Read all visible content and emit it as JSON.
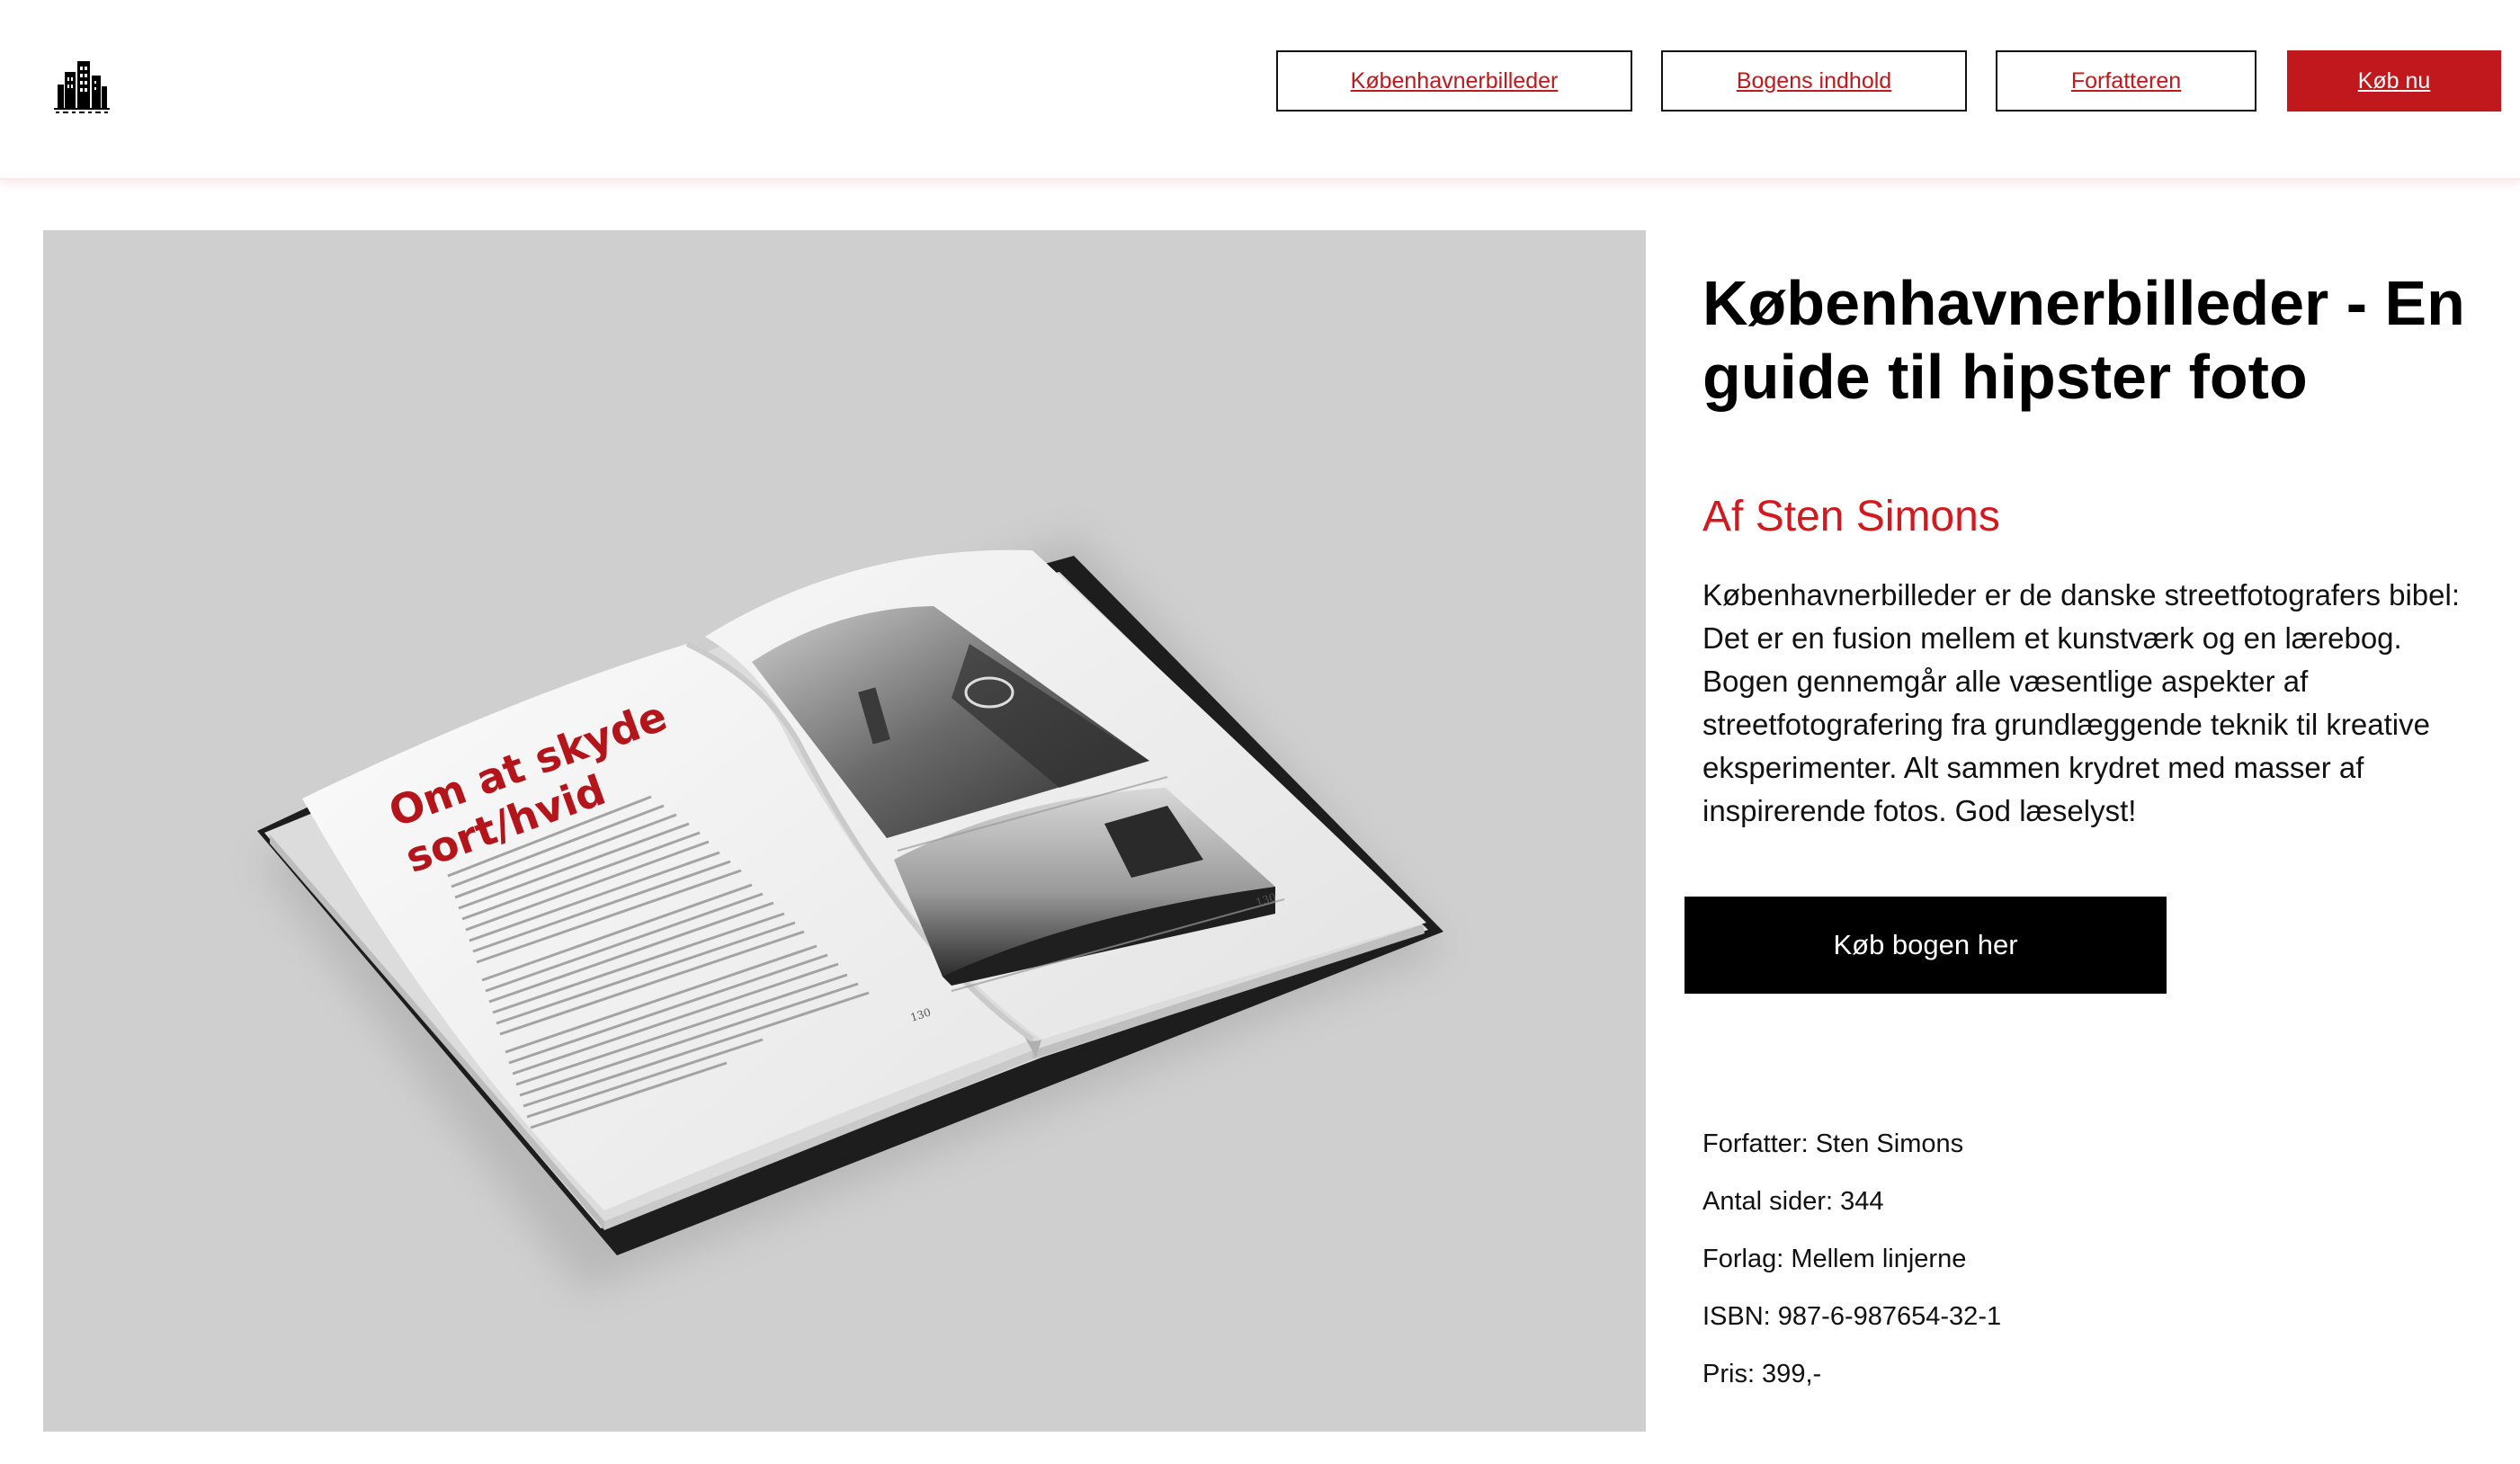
{
  "nav": {
    "items": [
      {
        "label": "Københavnerbilleder"
      },
      {
        "label": "Bogens indhold"
      },
      {
        "label": "Forfatteren"
      },
      {
        "label": "Køb nu"
      }
    ]
  },
  "hero": {
    "spread_heading_line1": "Om at skyde",
    "spread_heading_line2": "sort/hvid"
  },
  "book": {
    "title": "Københavnerbilleder - En guide til hipster foto",
    "byline": "Af Sten Simons",
    "description": "Københavnerbilleder er de danske streetfotografers bibel: Det er en fusion mellem et kunstværk og en lærebog. Bogen gennemgår alle væsentlige aspekter af streetfotografering fra grundlæggende teknik til kreative eksperimenter. Alt sammen krydret med masser af inspirerende fotos. God læselyst!",
    "cta_label": "Køb bogen her",
    "facts": {
      "author": "Forfatter: Sten Simons",
      "pages": "Antal sider: 344",
      "publisher": "Forlag: Mellem linjerne",
      "isbn": "ISBN: 987-6-987654-32-1",
      "price": "Pris: 399,-"
    }
  },
  "colors": {
    "accent": "#c0181c",
    "byline": "#d2191f",
    "hero_bg": "#cfcfcf",
    "cta_bg": "#000000"
  },
  "icons": {
    "logo": "city-buildings-logo-icon"
  }
}
